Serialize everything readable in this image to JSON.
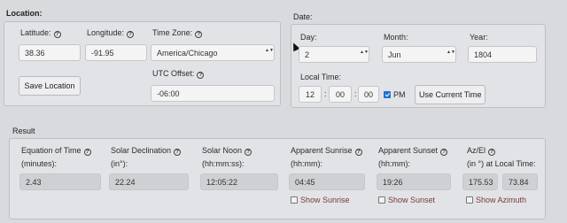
{
  "location": {
    "title": "Location:",
    "latitude_label": "Latitude:",
    "latitude_value": "38.36",
    "longitude_label": "Longitude:",
    "longitude_value": "-91.95",
    "timezone_label": "Time Zone:",
    "timezone_value": "America/Chicago",
    "save_label": "Save Location",
    "utc_label": "UTC Offset:",
    "utc_value": "-06:00"
  },
  "date": {
    "title": "Date:",
    "day_label": "Day:",
    "day_value": "2",
    "month_label": "Month:",
    "month_value": "Jun",
    "year_label": "Year:",
    "year_value": "1804",
    "local_time_label": "Local Time:",
    "hour": "12",
    "minute": "00",
    "second": "00",
    "pm_label": "PM",
    "pm_checked": true,
    "use_current_label": "Use Current Time"
  },
  "result": {
    "title": "Result",
    "eot_label_1": "Equation of Time",
    "eot_label_2": "(minutes):",
    "eot_value": "2.43",
    "decl_label_1": "Solar Declination",
    "decl_label_2": "(in°):",
    "decl_value": "22.24",
    "noon_label_1": "Solar Noon",
    "noon_label_2": "(hh:mm:ss):",
    "noon_value": "12:05:22",
    "sunrise_label_1": "Apparent Sunrise",
    "sunrise_label_2": "(hh:mm):",
    "sunrise_value": "04:45",
    "show_sunrise": "Show Sunrise",
    "sunset_label_1": "Apparent Sunset",
    "sunset_label_2": "(hh:mm):",
    "sunset_value": "19:26",
    "show_sunset": "Show Sunset",
    "azel_label_1": "Az/El",
    "azel_label_2": "(in °) at Local Time:",
    "az_value": "175.53",
    "el_value": "73.84",
    "show_azimuth": "Show Azimuth"
  },
  "icons": {
    "help": "?",
    "select_arrows": "▲▼"
  }
}
